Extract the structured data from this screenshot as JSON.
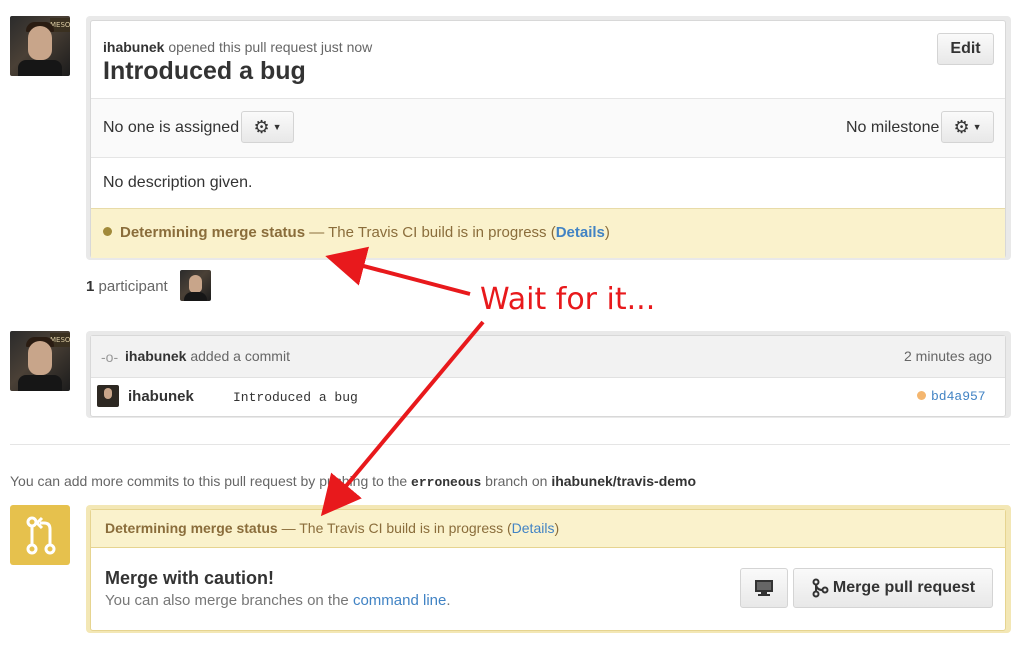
{
  "pr": {
    "author": "ihabunek",
    "opened_text": "opened this pull request just now",
    "title": "Introduced a bug",
    "edit_label": "Edit",
    "assignee_text": "No one is assigned",
    "milestone_text": "No milestone",
    "description": "No description given.",
    "merge_status_label": "Determining merge status",
    "merge_status_text": "— The Travis CI build is in progress (",
    "details_label": "Details",
    "close_paren": ")"
  },
  "participants": {
    "count": "1",
    "label": "participant"
  },
  "annotation": {
    "text": "Wait for it...",
    "color": "#e8191c"
  },
  "commit_event": {
    "author": "ihabunek",
    "action": "added a commit",
    "time": "2 minutes ago",
    "commit_author": "ihabunek",
    "commit_message": "Introduced a bug",
    "commit_sha": "bd4a957",
    "status_color": "#f4b66f"
  },
  "push_note": {
    "prefix": "You can add more commits to this pull request by pushing to the",
    "branch": "erroneous",
    "middle": "branch on",
    "repo": "ihabunek/travis-demo"
  },
  "merge_box": {
    "status_label": "Determining merge status",
    "status_text": "— The Travis CI build is in progress (",
    "details_label": "Details",
    "close_paren": ")",
    "heading": "Merge with caution!",
    "sub_prefix": "You can also merge branches on the",
    "sub_link": "command line",
    "sub_suffix": ".",
    "merge_button_label": "Merge pull request"
  },
  "colors": {
    "yellow_bg": "#faf2cc",
    "yellow_text": "#8a6d3b",
    "link": "#4183c4",
    "merge_icon_bg": "#e6c14d"
  }
}
